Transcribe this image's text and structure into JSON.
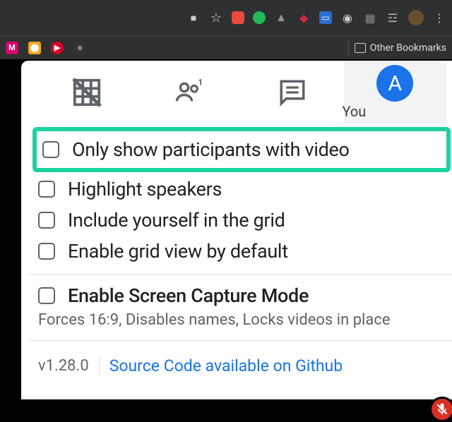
{
  "chrome": {
    "other_bookmarks": "Other Bookmarks"
  },
  "tabs": {
    "you_label": "You",
    "avatar_letter": "A"
  },
  "options": {
    "only_video": "Only show participants with video",
    "highlight_speakers": "Highlight speakers",
    "include_self": "Include yourself in the grid",
    "enable_default": "Enable grid view by default",
    "screen_capture": "Enable Screen Capture Mode",
    "screen_capture_help": "Forces 16:9, Disables names, Locks videos in place"
  },
  "footer": {
    "version": "v1.28.0",
    "link": "Source Code available on Github"
  }
}
